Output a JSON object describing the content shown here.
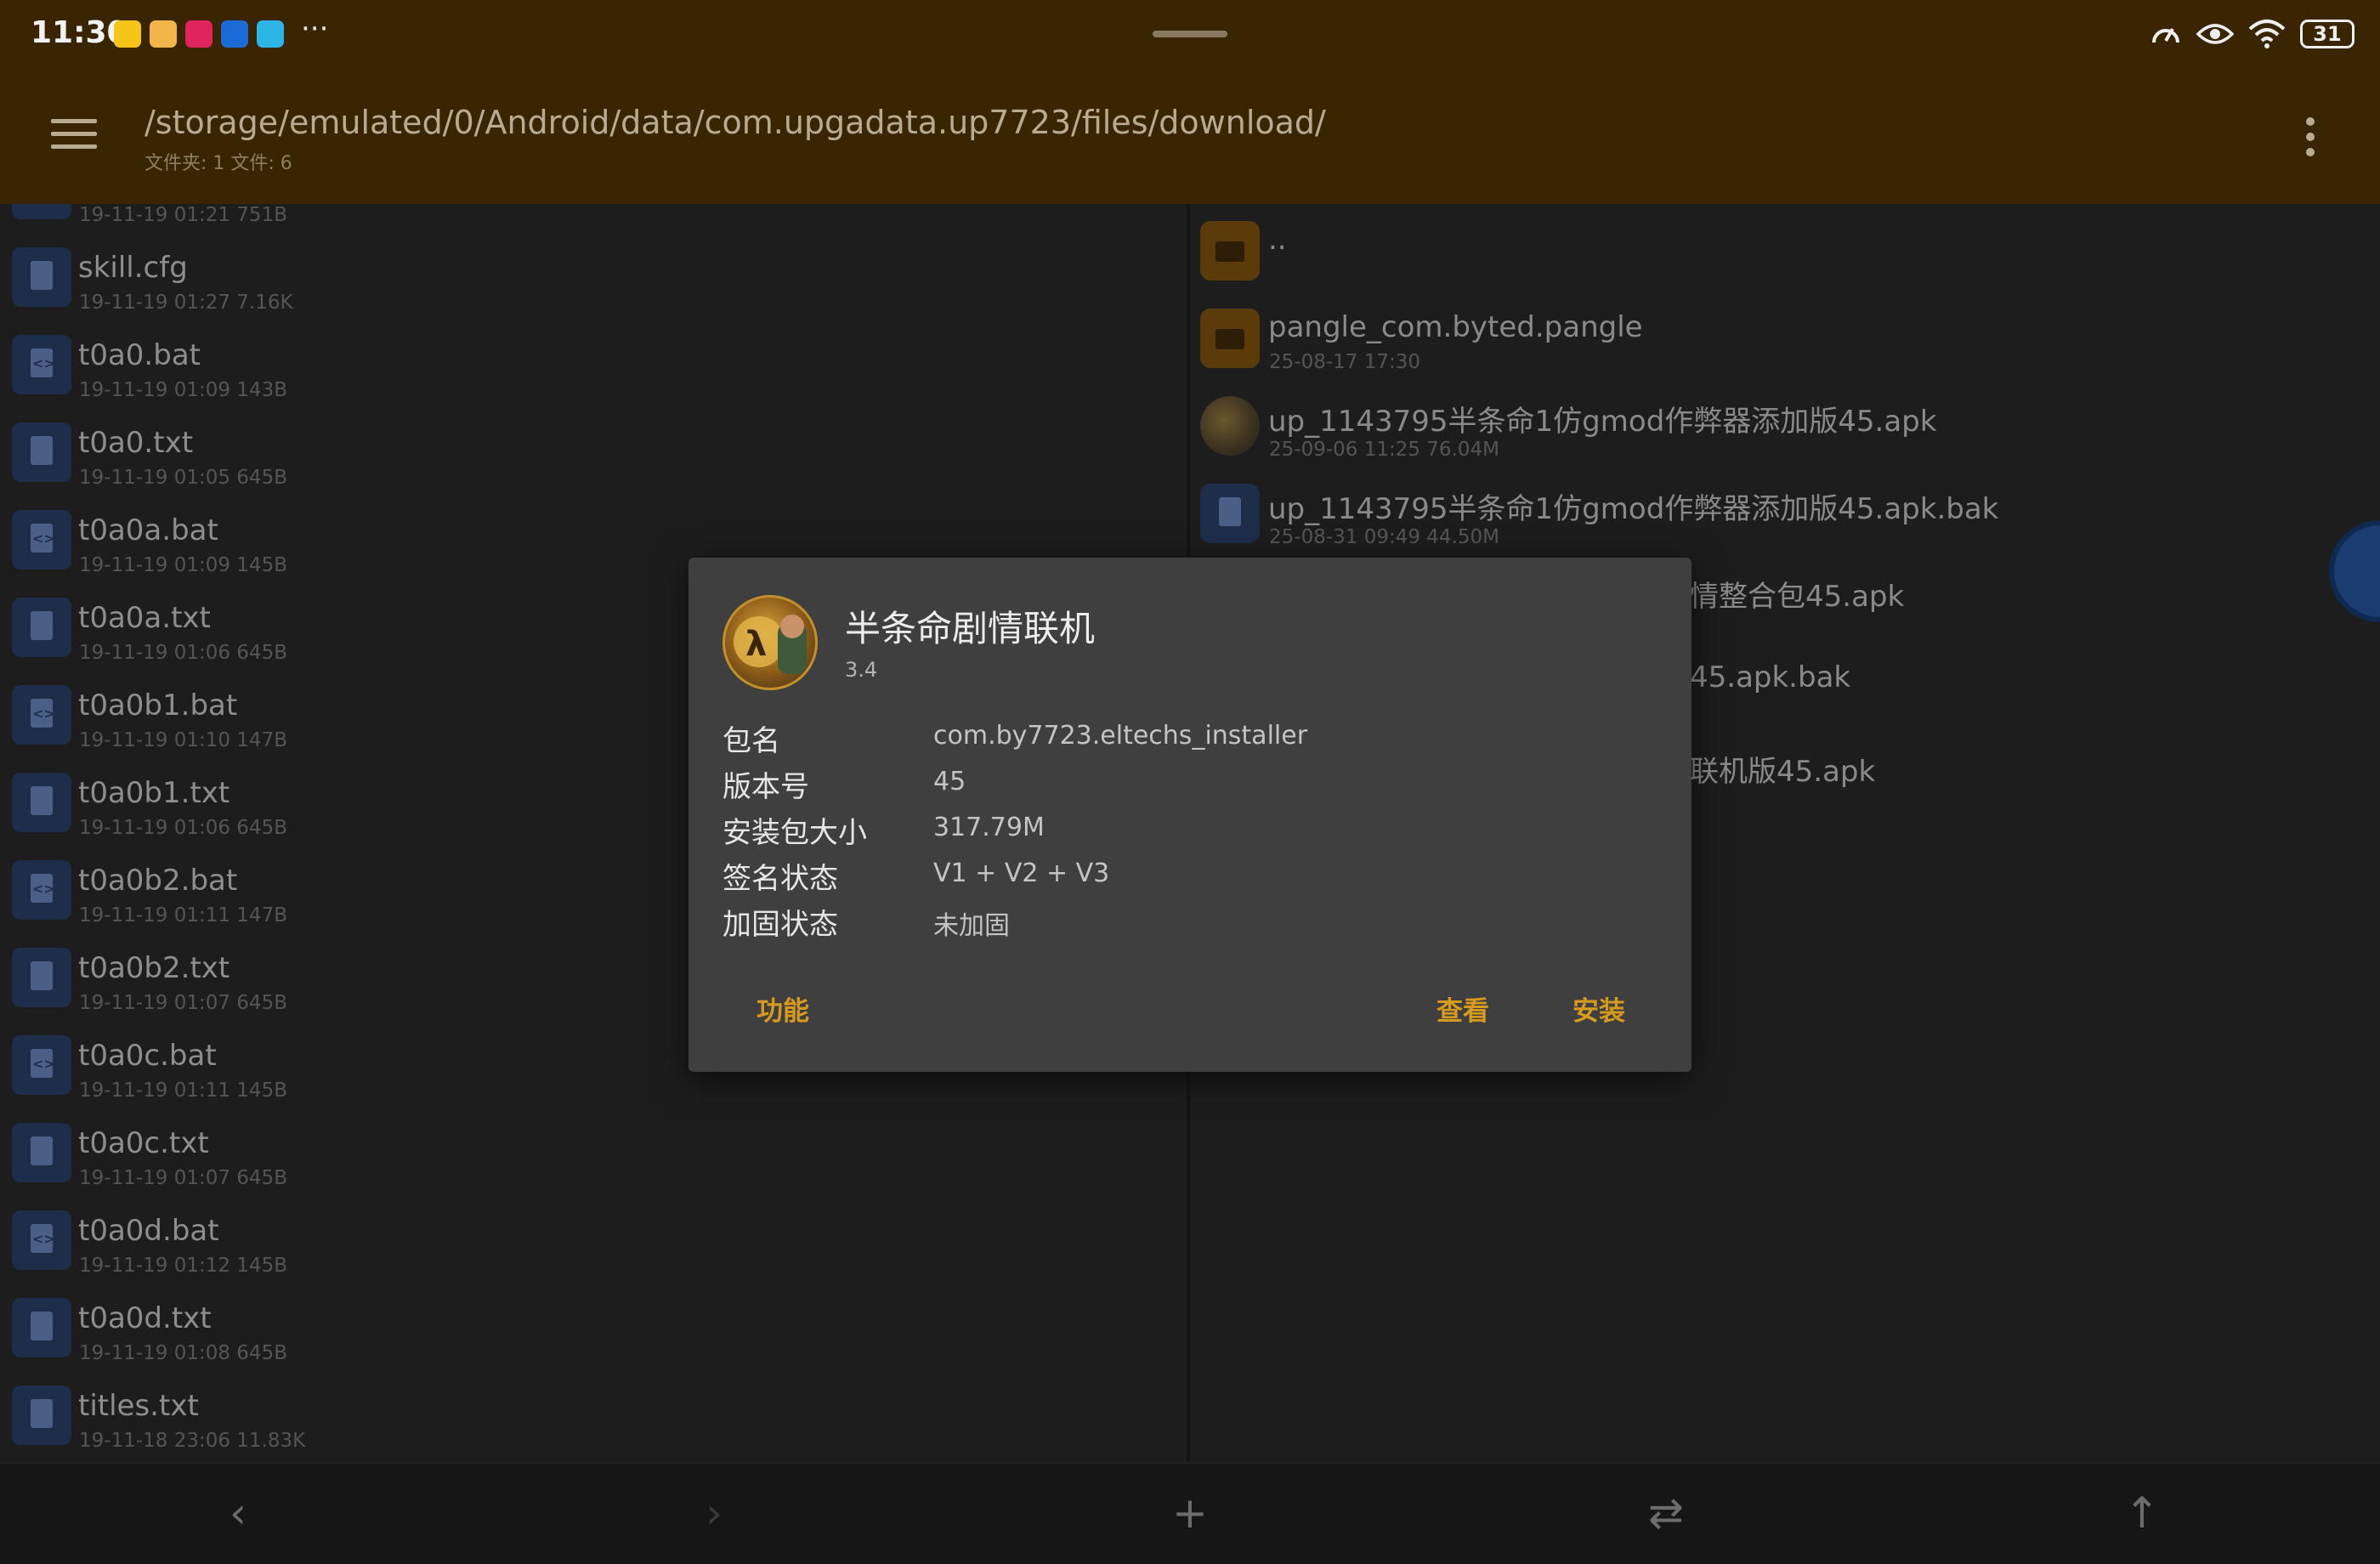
{
  "status_bar": {
    "time": "11:30",
    "more": "···",
    "battery": "31",
    "notification_icons": [
      "app-notification-icon-1",
      "app-notification-icon-2",
      "app-notification-icon-3",
      "app-notification-icon-4",
      "app-notification-icon-5"
    ],
    "notification_colors": [
      "#f5c518",
      "#f2b54a",
      "#e0245e",
      "#1a6bd6",
      "#2bb6e6"
    ]
  },
  "header": {
    "path": "/storage/emulated/0/Android/data/com.upgadata.up7723/files/download/",
    "summary": "文件夹: 1  文件: 6",
    "menu_icon": "hamburger-menu-icon",
    "overflow_icon": "more-vertical-icon",
    "accent_color": "#3a2502"
  },
  "left_pane": {
    "files": [
      {
        "name": "",
        "meta": "19-11-19 01:21  751B",
        "kind": "doc"
      },
      {
        "name": "skill.cfg",
        "meta": "19-11-19 01:27  7.16K",
        "kind": "doc"
      },
      {
        "name": "t0a0.bat",
        "meta": "19-11-19 01:09  143B",
        "kind": "code"
      },
      {
        "name": "t0a0.txt",
        "meta": "19-11-19 01:05  645B",
        "kind": "doc"
      },
      {
        "name": "t0a0a.bat",
        "meta": "19-11-19 01:09  145B",
        "kind": "code"
      },
      {
        "name": "t0a0a.txt",
        "meta": "19-11-19 01:06  645B",
        "kind": "doc"
      },
      {
        "name": "t0a0b1.bat",
        "meta": "19-11-19 01:10  147B",
        "kind": "code"
      },
      {
        "name": "t0a0b1.txt",
        "meta": "19-11-19 01:06  645B",
        "kind": "doc"
      },
      {
        "name": "t0a0b2.bat",
        "meta": "19-11-19 01:11  147B",
        "kind": "code"
      },
      {
        "name": "t0a0b2.txt",
        "meta": "19-11-19 01:07  645B",
        "kind": "doc"
      },
      {
        "name": "t0a0c.bat",
        "meta": "19-11-19 01:11  145B",
        "kind": "code"
      },
      {
        "name": "t0a0c.txt",
        "meta": "19-11-19 01:07  645B",
        "kind": "doc"
      },
      {
        "name": "t0a0d.bat",
        "meta": "19-11-19 01:12  145B",
        "kind": "code"
      },
      {
        "name": "t0a0d.txt",
        "meta": "19-11-19 01:08  645B",
        "kind": "doc"
      },
      {
        "name": "titles.txt",
        "meta": "19-11-18 23:06  11.83K",
        "kind": "doc"
      }
    ]
  },
  "right_pane": {
    "entries": [
      {
        "name": "..",
        "meta": "",
        "kind": "folder"
      },
      {
        "name": "pangle_com.byted.pangle",
        "meta": "25-08-17 17:30",
        "kind": "folder"
      },
      {
        "name": "up_1143795半条命1仿gmod作弊器添加版45.apk",
        "meta": "25-09-06 11:25  76.04M",
        "kind": "app"
      },
      {
        "name": "up_1143795半条命1仿gmod作弊器添加版45.apk.bak",
        "meta": "25-08-31 09:49  44.50M",
        "kind": "doc"
      },
      {
        "name": "情整合包45.apk",
        "meta": "",
        "kind": "partial"
      },
      {
        "name": "45.apk.bak",
        "meta": "",
        "kind": "partial"
      },
      {
        "name": "联机版45.apk",
        "meta": "",
        "kind": "partial"
      }
    ]
  },
  "dialog": {
    "title": "半条命剧情联机",
    "version": "3.4",
    "rows": [
      {
        "label": "包名",
        "value": "com.by7723.eltechs_installer"
      },
      {
        "label": "版本号",
        "value": "45"
      },
      {
        "label": "安装包大小",
        "value": "317.79M"
      },
      {
        "label": "签名状态",
        "value": "V1 + V2 + V3"
      },
      {
        "label": "加固状态",
        "value": "未加固"
      }
    ],
    "buttons": {
      "functions": "功能",
      "view": "查看",
      "install": "安装"
    },
    "button_color": "#d69a1e"
  },
  "bottom_bar": {
    "back": "‹",
    "forward": "›",
    "add": "+",
    "swap": "⇄",
    "up": "↑"
  }
}
